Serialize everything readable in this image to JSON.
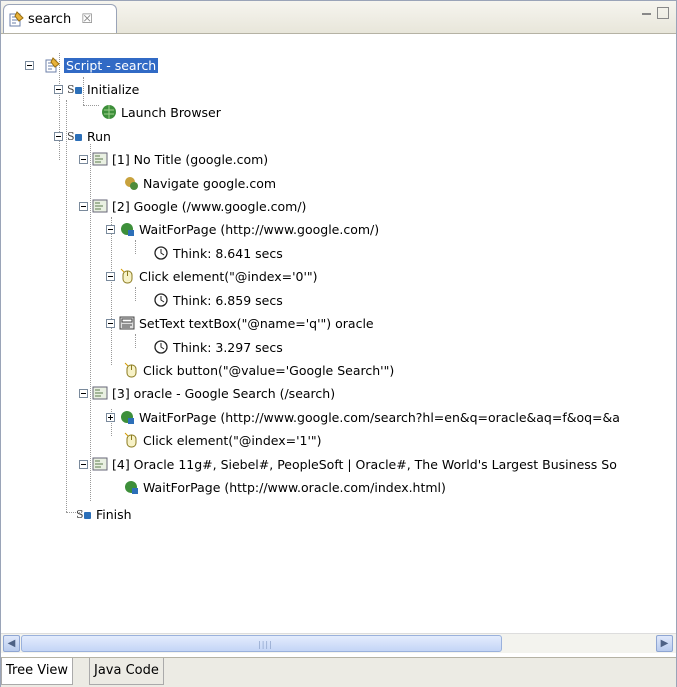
{
  "tab": {
    "title": "search",
    "close": "☒"
  },
  "tree": {
    "root": "Script - search",
    "initialize": "Initialize",
    "launch_browser": "Launch Browser",
    "run": "Run",
    "page1": "[1] No Title (google.com)",
    "navigate": "Navigate google.com",
    "page2": "[2] Google (/www.google.com/)",
    "wait1": "WaitForPage (http://www.google.com/)",
    "think1": "Think: 8.641 secs",
    "click1": "Click element(\"@index='0'\")",
    "think2": "Think: 6.859 secs",
    "settext": "SetText textBox(\"@name='q'\") oracle",
    "think3": "Think: 3.297 secs",
    "click_button": "Click button(\"@value='Google Search'\")",
    "page3": "[3] oracle - Google Search (/search)",
    "wait2": "WaitForPage (http://www.google.com/search?hl=en&q=oracle&aq=f&oq=&a",
    "click2": "Click element(\"@index='1'\")",
    "page4": "[4] Oracle 11g#, Siebel#, PeopleSoft | Oracle#, The World's Largest Business So",
    "wait3": "WaitForPage (http://www.oracle.com/index.html)",
    "finish": "Finish"
  },
  "scrollbar": {
    "grip": "||||"
  },
  "bottom_tabs": {
    "tree_view": "Tree View",
    "java_code": "Java Code"
  },
  "colors": {
    "selection": "#316ac5"
  }
}
